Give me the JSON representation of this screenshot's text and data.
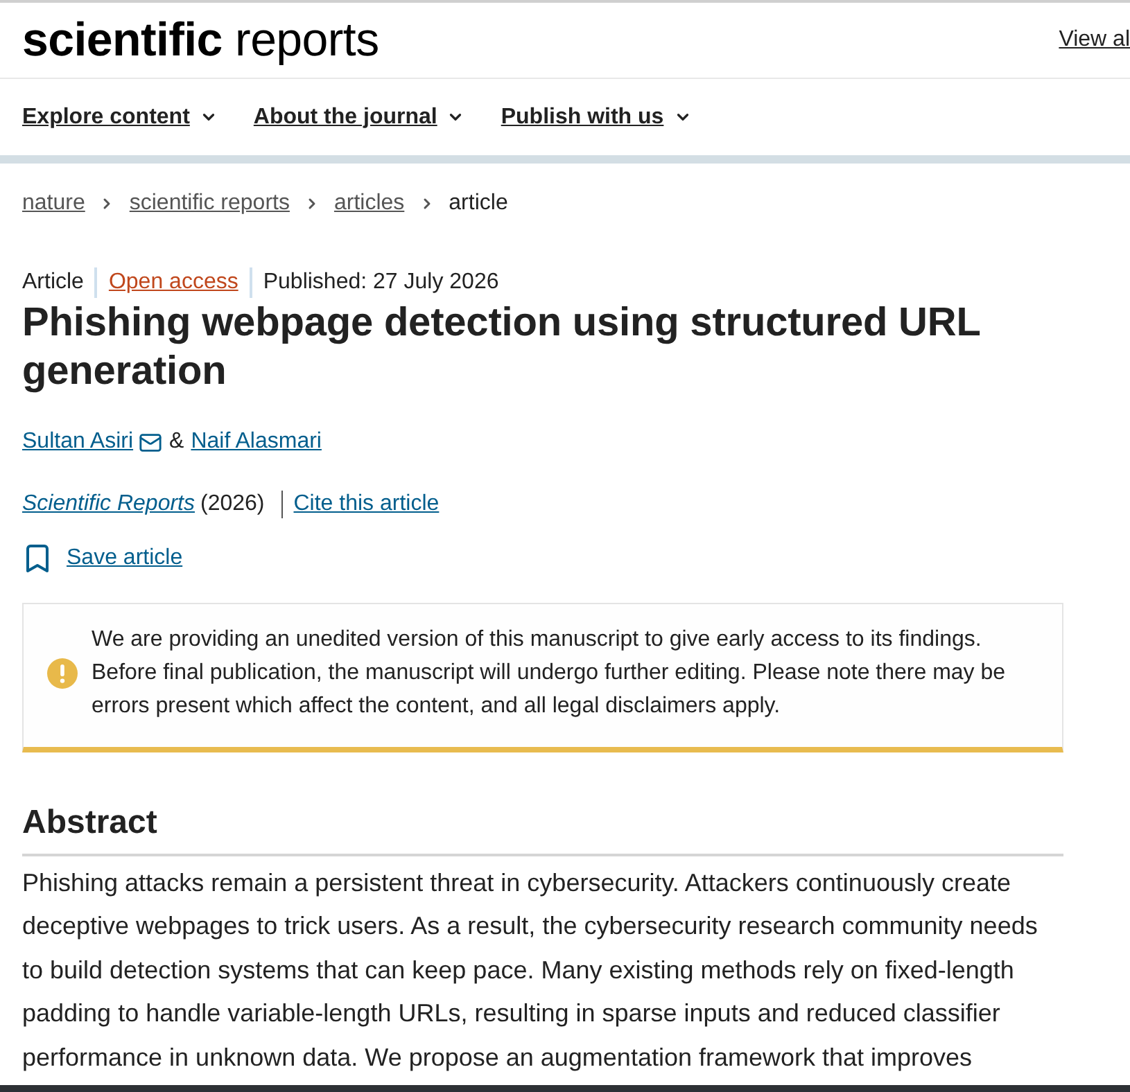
{
  "header": {
    "logo": {
      "bold_part": "scientific",
      "light_part": "reports"
    },
    "top_link": "View al"
  },
  "nav": [
    {
      "label": "Explore content"
    },
    {
      "label": "About the journal"
    },
    {
      "label": "Publish with us"
    }
  ],
  "breadcrumb": [
    {
      "label": "nature",
      "kind": "link"
    },
    {
      "label": "scientific reports",
      "kind": "link"
    },
    {
      "label": "articles",
      "kind": "link"
    },
    {
      "label": "article",
      "kind": "current"
    }
  ],
  "article": {
    "meta": [
      {
        "label": "Article",
        "kind": "type"
      },
      {
        "label": "Open access",
        "kind": "access"
      },
      {
        "label": "Published: 27 July 2026",
        "kind": "date"
      }
    ],
    "title": "Phishing webpage detection using structured URL generation",
    "authors": [
      {
        "name": "Sultan Asiri",
        "corresponding": true
      },
      {
        "name": "Naif Alasmari",
        "corresponding": false
      }
    ],
    "author_separator": "&",
    "journal": "Scientific Reports",
    "year": "(2026)",
    "cite_link": "Cite this article",
    "save_link": "Save article"
  },
  "notice": {
    "text": "We are providing an unedited version of this manuscript to give early access to its findings. Before final publication, the manuscript will undergo further editing. Please note there may be errors present which affect the content, and all legal disclaimers apply."
  },
  "abstract": {
    "heading": "Abstract",
    "paragraph": "Phishing attacks remain a persistent threat in cybersecurity. Attackers continuously create deceptive webpages to trick users. As a result, the cybersecurity research community needs to build detection systems that can keep pace. Many existing methods rely on fixed-length padding to handle variable-length URLs, resulting in sparse inputs and reduced classifier performance in unknown data. We propose an augmentation framework that improves"
  }
}
